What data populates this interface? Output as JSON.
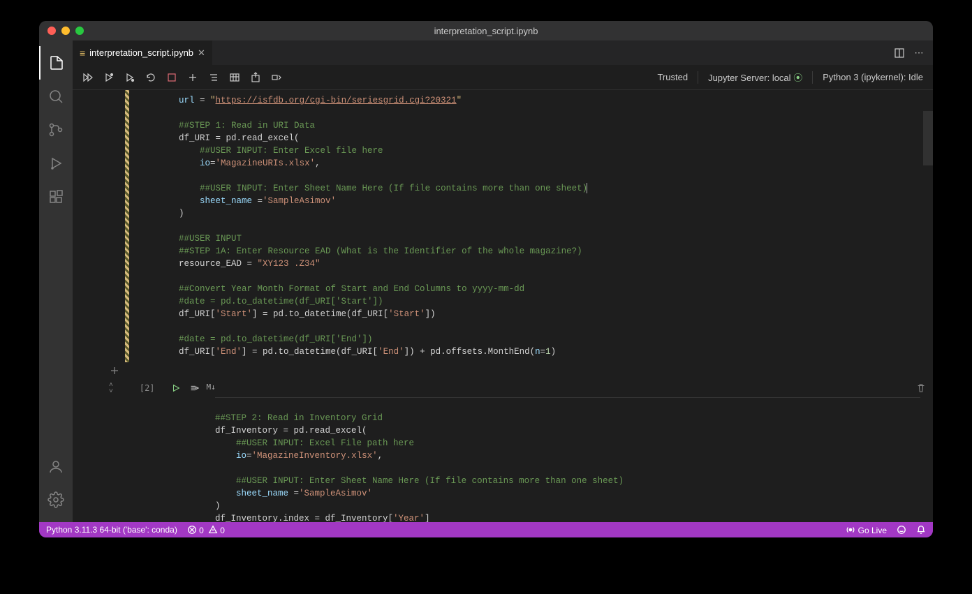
{
  "window": {
    "title": "interpretation_script.ipynb"
  },
  "tab": {
    "filename": "interpretation_script.ipynb"
  },
  "notebook_toolbar": {
    "trusted": "Trusted",
    "server": "Jupyter Server: local",
    "kernel": "Python 3 (ipykernel): Idle"
  },
  "cell1": {
    "lines": [
      [
        [
          "var",
          "url"
        ],
        [
          "default",
          " = "
        ],
        [
          "lstr",
          "\""
        ],
        [
          "url",
          "https://isfdb.org/cgi-bin/seriesgrid.cgi?20321"
        ],
        [
          "lstr",
          "\""
        ]
      ],
      [],
      [
        [
          "comment",
          "##STEP 1: Read in URI Data"
        ]
      ],
      [
        [
          "default",
          "df_URI = pd.read_excel("
        ]
      ],
      [
        [
          "default",
          "    "
        ],
        [
          "comment",
          "##USER INPUT: Enter Excel file here"
        ]
      ],
      [
        [
          "default",
          "    "
        ],
        [
          "param",
          "io"
        ],
        [
          "default",
          "="
        ],
        [
          "str",
          "'MagazineURIs.xlsx'"
        ],
        [
          "default",
          ","
        ]
      ],
      [],
      [
        [
          "default",
          "    "
        ],
        [
          "comment",
          "##USER INPUT: Enter Sheet Name Here (If file contains more than one sheet)"
        ],
        [
          "cursor",
          ""
        ]
      ],
      [
        [
          "default",
          "    "
        ],
        [
          "param",
          "sheet_name"
        ],
        [
          "default",
          " ="
        ],
        [
          "str",
          "'SampleAsimov'"
        ]
      ],
      [
        [
          "default",
          ")"
        ]
      ],
      [],
      [
        [
          "comment",
          "##USER INPUT"
        ]
      ],
      [
        [
          "comment",
          "##STEP 1A: Enter Resource EAD (What is the Identifier of the whole magazine?)"
        ]
      ],
      [
        [
          "default",
          "resource_EAD = "
        ],
        [
          "str",
          "\"XY123 .Z34\""
        ]
      ],
      [],
      [
        [
          "comment",
          "##Convert Year Month Format of Start and End Columns to yyyy-mm-dd"
        ]
      ],
      [
        [
          "comment",
          "#date = pd.to_datetime(df_URI['Start'])"
        ]
      ],
      [
        [
          "default",
          "df_URI["
        ],
        [
          "str",
          "'Start'"
        ],
        [
          "default",
          "] = pd.to_datetime(df_URI["
        ],
        [
          "str",
          "'Start'"
        ],
        [
          "default",
          "])"
        ]
      ],
      [],
      [
        [
          "comment",
          "#date = pd.to_datetime(df_URI['End'])"
        ]
      ],
      [
        [
          "default",
          "df_URI["
        ],
        [
          "str",
          "'End'"
        ],
        [
          "default",
          "] = pd.to_datetime(df_URI["
        ],
        [
          "str",
          "'End'"
        ],
        [
          "default",
          "]) + pd.offsets.MonthEnd("
        ],
        [
          "param",
          "n"
        ],
        [
          "default",
          "="
        ],
        [
          "num",
          "1"
        ],
        [
          "default",
          ")"
        ]
      ]
    ]
  },
  "cell2": {
    "exec_count": "[2]",
    "markdown_label": "M↓",
    "lines": [
      [
        [
          "comment",
          "##STEP 2: Read in Inventory Grid"
        ]
      ],
      [
        [
          "default",
          "df_Inventory = pd.read_excel("
        ]
      ],
      [
        [
          "default",
          "    "
        ],
        [
          "comment",
          "##USER INPUT: Excel File path here"
        ]
      ],
      [
        [
          "default",
          "    "
        ],
        [
          "param",
          "io"
        ],
        [
          "default",
          "="
        ],
        [
          "str",
          "'MagazineInventory.xlsx'"
        ],
        [
          "default",
          ","
        ]
      ],
      [],
      [
        [
          "default",
          "    "
        ],
        [
          "comment",
          "##USER INPUT: Enter Sheet Name Here (If file contains more than one sheet)"
        ]
      ],
      [
        [
          "default",
          "    "
        ],
        [
          "param",
          "sheet_name"
        ],
        [
          "default",
          " ="
        ],
        [
          "str",
          "'SampleAsimov'"
        ]
      ],
      [
        [
          "default",
          ")"
        ]
      ],
      [
        [
          "default",
          "df_Inventory.index = df_Inventory["
        ],
        [
          "str",
          "'Year'"
        ],
        [
          "default",
          "]"
        ]
      ]
    ]
  },
  "statusbar": {
    "python": "Python 3.11.3 64-bit ('base': conda)",
    "errors": "0",
    "warnings": "0",
    "golive": "Go Live"
  }
}
